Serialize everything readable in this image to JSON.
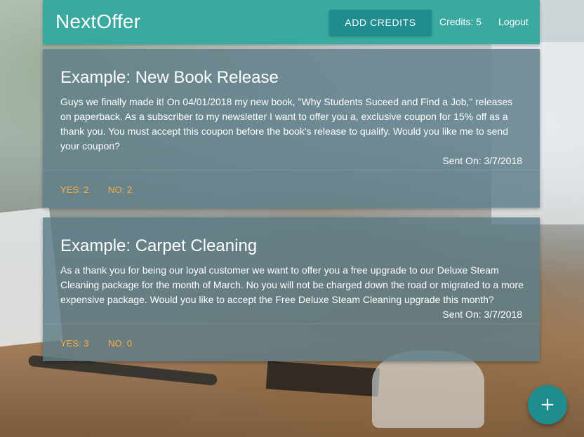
{
  "header": {
    "brand": "NextOffer",
    "add_credits_label": "ADD CREDITS",
    "credits_text": "Credits: 5",
    "logout_label": "Logout"
  },
  "surveys": [
    {
      "title": "Example: New Book Release",
      "body": "Guys we finally made it! On 04/01/2018 my new book, \"Why Students Suceed and Find a Job,\" releases on paperback. As a subscriber to my newsletter I want to offer you a, exclusive coupon for 15% off as a thank you. You must accept this coupon before the book's release to qualify. Would you like me to send your coupon?",
      "sent": "Sent On: 3/7/2018",
      "yes": "YES: 2",
      "no": "NO: 2"
    },
    {
      "title": "Example: Carpet Cleaning",
      "body": "As a thank you for being our loyal customer we want to offer you a free upgrade to our Deluxe Steam Cleaning package for the month of March. No you will not be charged down the road or migrated to a more expensive package. Would you like to accept the Free Deluxe Steam Cleaning upgrade this month?",
      "sent": "Sent On: 3/7/2018",
      "yes": "YES: 3",
      "no": "NO: 0"
    }
  ],
  "fab": {
    "icon": "plus-icon",
    "symbol": "+"
  },
  "colors": {
    "navbar": "#3aa99f",
    "button": "#1f8c8f",
    "accent": "#ffab40",
    "card": "#5d7d88"
  }
}
